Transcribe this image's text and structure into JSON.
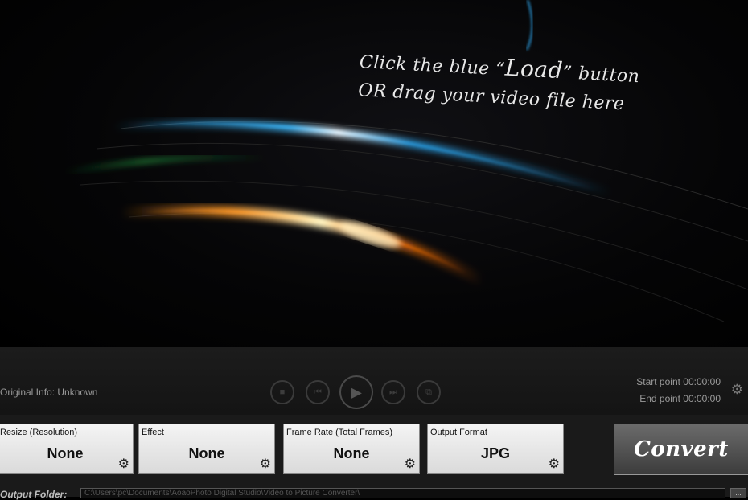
{
  "preview": {
    "hint_line1_prefix": "Click the blue “",
    "hint_line1_load": "Load",
    "hint_line1_suffix": "” button",
    "hint_line2": "OR drag your video file here"
  },
  "controls": {
    "original_info": "Original Info: Unknown",
    "start_point": "Start point 00:00:00",
    "end_point": "End point 00:00:00",
    "stop_icon": "■",
    "prev_icon": "⏮",
    "play_icon": "▶",
    "next_icon": "⏭",
    "snapshot_icon": "⧉",
    "gear_icon": "⚙"
  },
  "settings": {
    "cards": [
      {
        "title": "Resize (Resolution)",
        "value": "None"
      },
      {
        "title": "Effect",
        "value": "None"
      },
      {
        "title": "Frame Rate (Total Frames)",
        "value": "None"
      },
      {
        "title": "Output Format",
        "value": "JPG"
      }
    ],
    "convert_label": "Convert"
  },
  "output": {
    "label": "Output Folder:",
    "path": "C:\\Users\\pc\\Documents\\AoaoPhoto Digital Studio\\Video to Picture Converter\\",
    "browse_label": "..."
  },
  "colors": {
    "blue_streak": "#2aa0e6",
    "orange_streak": "#ff8a1a",
    "green_streak": "#1f8f3a"
  }
}
